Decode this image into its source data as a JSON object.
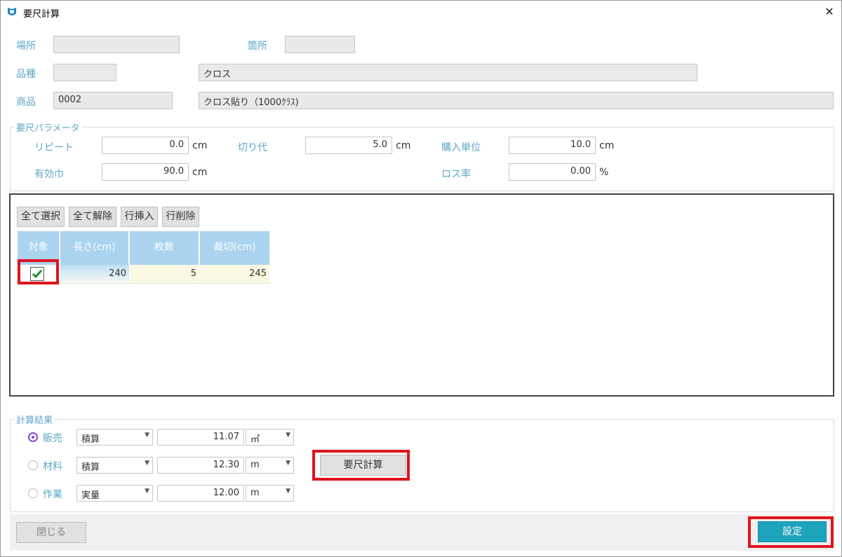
{
  "window": {
    "title": "要尺計算",
    "close_glyph": "✕"
  },
  "header": {
    "basho_label": "場所",
    "basho_value": "",
    "kasho_label": "箇所",
    "kasho_value": "",
    "hinshu_label": "品種",
    "hinshu_code": "",
    "hinshu_name": "クロス",
    "shohin_label": "商品",
    "shohin_code": "0002",
    "shohin_name": "クロス貼り（1000ｸﾗｽ)"
  },
  "params": {
    "group_title": "要尺パラメータ",
    "repeat_label": "リピート",
    "repeat_value": "0.0",
    "repeat_unit": "cm",
    "kiri_label": "切り代",
    "kiri_value": "5.0",
    "kiri_unit": "cm",
    "konyu_label": "購入単位",
    "konyu_value": "10.0",
    "konyu_unit": "cm",
    "yuko_label": "有効巾",
    "yuko_value": "90.0",
    "yuko_unit": "cm",
    "loss_label": "ロス率",
    "loss_value": "0.00",
    "loss_unit": "%"
  },
  "grid": {
    "toolbar": [
      "全て選択",
      "全て解除",
      "行挿入",
      "行削除"
    ],
    "columns": [
      "対象",
      "長さ(cm)",
      "枚数",
      "裁切(cm)"
    ],
    "rows": [
      {
        "checked": true,
        "length": "240",
        "count": "5",
        "cut": "245"
      }
    ]
  },
  "results": {
    "group_title": "計算結果",
    "rows": [
      {
        "label": "販売",
        "selected": true,
        "method": "積算",
        "value": "11.07",
        "unit": "㎡"
      },
      {
        "label": "材料",
        "selected": false,
        "method": "積算",
        "value": "12.30",
        "unit": "m"
      },
      {
        "label": "作業",
        "selected": false,
        "method": "実量",
        "value": "12.00",
        "unit": "m"
      }
    ],
    "calc_button": "要尺計算"
  },
  "footer": {
    "close_button": "閉じる",
    "set_button": "設定"
  },
  "colors": {
    "label": "#5ca7c9",
    "header": "#aad4ef",
    "primary": "#1ea3bd",
    "highlight": "#e0131f",
    "radio": "#7b4fcf"
  },
  "icons": {
    "app": "app-logo-icon",
    "close": "close-icon",
    "check": "check-icon",
    "dropdown": "chevron-down-icon"
  }
}
